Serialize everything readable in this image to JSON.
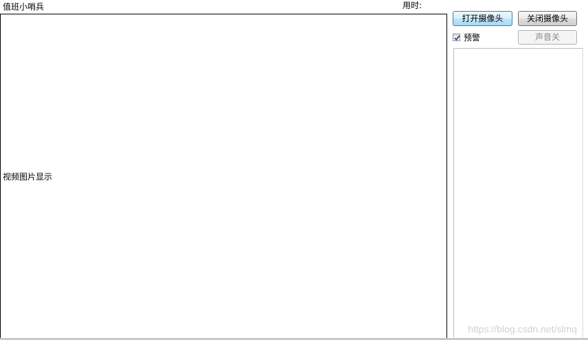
{
  "header": {
    "app_title": "值班小哨兵",
    "elapsed_label": "用时:"
  },
  "video": {
    "placeholder_text": "视频图片显示"
  },
  "controls": {
    "open_camera_label": "打开摄像头",
    "close_camera_label": "关闭摄像头",
    "warning_label": "预警",
    "warning_checked": true,
    "sound_button_label": "声音关"
  },
  "watermark": "https://blog.csdn.net/slmq",
  "colors": {
    "open_button_accent": "#3c7fb1",
    "checkmark": "#1f3f8f"
  }
}
